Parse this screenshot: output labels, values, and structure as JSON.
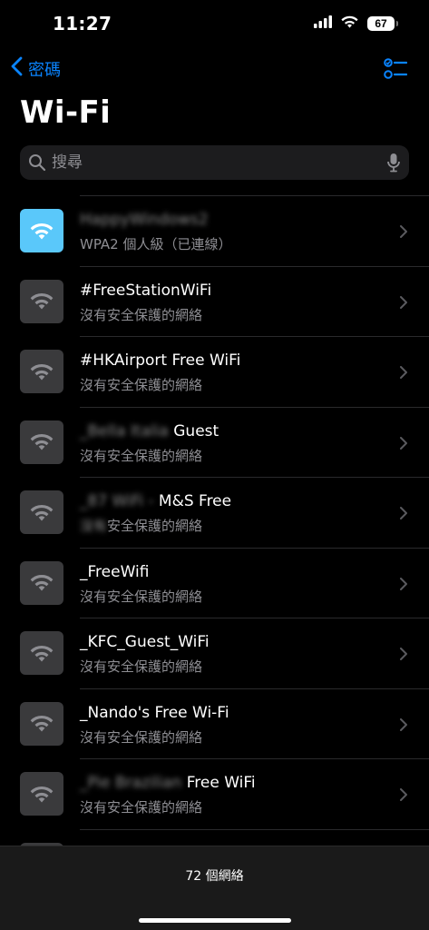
{
  "status_bar": {
    "time": "11:27",
    "battery": "67",
    "icons": [
      "cellular-signal-icon",
      "wifi-icon",
      "battery-icon"
    ]
  },
  "nav": {
    "back_label": "密碼",
    "back_icon": "chevron-left-icon",
    "right_icon": "checklist-icon"
  },
  "page": {
    "title": "Wi-Fi"
  },
  "search": {
    "placeholder": "搜尋",
    "value": ""
  },
  "networks": [
    {
      "name_hidden": "HappyWindows2",
      "name_visible": "",
      "subtitle": "WPA2 個人級（已連線）",
      "subtitle_hidden": "",
      "connected": true
    },
    {
      "name_hidden": "",
      "name_visible": "#FreeStationWiFi",
      "subtitle": "沒有安全保護的網絡",
      "subtitle_hidden": "",
      "connected": false
    },
    {
      "name_hidden": "",
      "name_visible": "#HKAirport Free WiFi",
      "subtitle": "沒有安全保護的網絡",
      "subtitle_hidden": "",
      "connected": false
    },
    {
      "name_hidden": "_Bella Italia",
      "name_visible": " Guest",
      "subtitle": "沒有安全保護的網絡",
      "subtitle_hidden": "",
      "connected": false
    },
    {
      "name_hidden": "_87 WiFi -",
      "name_visible": " M&S Free",
      "subtitle": "安全保護的網絡",
      "subtitle_hidden": "沒有",
      "connected": false
    },
    {
      "name_hidden": "",
      "name_visible": "_FreeWifi",
      "subtitle": "沒有安全保護的網絡",
      "subtitle_hidden": "",
      "connected": false
    },
    {
      "name_hidden": "",
      "name_visible": "_KFC_Guest_WiFi",
      "subtitle": "沒有安全保護的網絡",
      "subtitle_hidden": "",
      "connected": false
    },
    {
      "name_hidden": "",
      "name_visible": "_Nando's Free Wi-Fi",
      "subtitle": "沒有安全保護的網絡",
      "subtitle_hidden": "",
      "connected": false
    },
    {
      "name_hidden": "_Pie Brazilian",
      "name_visible": " Free WiFi",
      "subtitle": "沒有安全保護的網絡",
      "subtitle_hidden": "",
      "connected": false
    }
  ],
  "footer": {
    "network_count": "72 個網絡"
  },
  "colors": {
    "accent": "#0a84ff",
    "connected_tile": "#5ac8fa",
    "tile": "#3a3a3c",
    "secondary_text": "#8e8e93",
    "background": "#000000"
  }
}
